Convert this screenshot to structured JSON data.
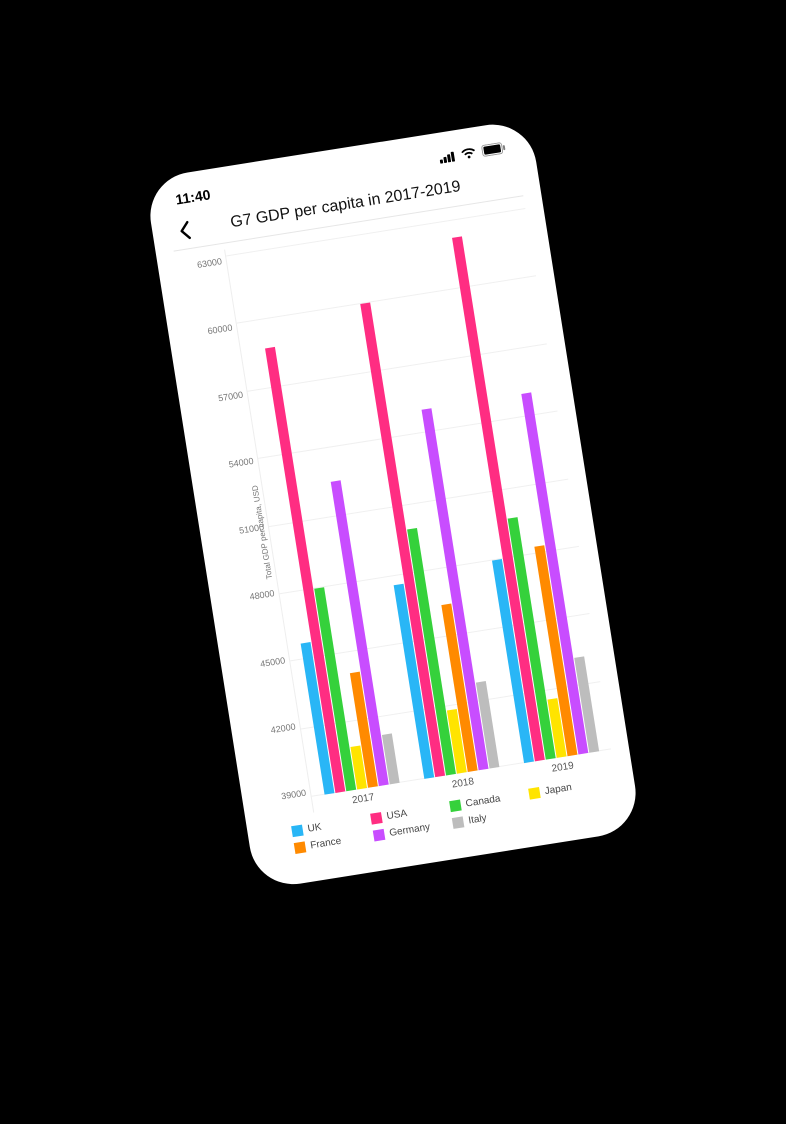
{
  "status": {
    "time": "11:40"
  },
  "nav": {
    "title": "G7 GDP per capita in 2017-2019"
  },
  "chart_data": {
    "type": "bar",
    "title": "G7 GDP per capita in 2017-2019",
    "ylabel": "Total GDP per capita, USD",
    "xlabel": "",
    "ylim": [
      39000,
      63000
    ],
    "yticks": [
      63000,
      60000,
      57000,
      54000,
      51000,
      48000,
      45000,
      42000,
      39000
    ],
    "categories": [
      "2017",
      "2018",
      "2019"
    ],
    "series": [
      {
        "name": "UK",
        "color": "#29b6f6",
        "values": [
          45700,
          47600,
          48000
        ]
      },
      {
        "name": "USA",
        "color": "#ff2d82",
        "values": [
          58700,
          60000,
          62200
        ]
      },
      {
        "name": "Canada",
        "color": "#35d13b",
        "values": [
          48000,
          49900,
          49700
        ]
      },
      {
        "name": "Japan",
        "color": "#ffe400",
        "values": [
          40900,
          41800,
          41600
        ]
      },
      {
        "name": "France",
        "color": "#ff8a00",
        "values": [
          44100,
          46400,
          48300
        ]
      },
      {
        "name": "Germany",
        "color": "#c84dff",
        "values": [
          52500,
          55000,
          55000
        ]
      },
      {
        "name": "Italy",
        "color": "#bdbdbd",
        "values": [
          41200,
          42800,
          43200
        ]
      }
    ]
  }
}
